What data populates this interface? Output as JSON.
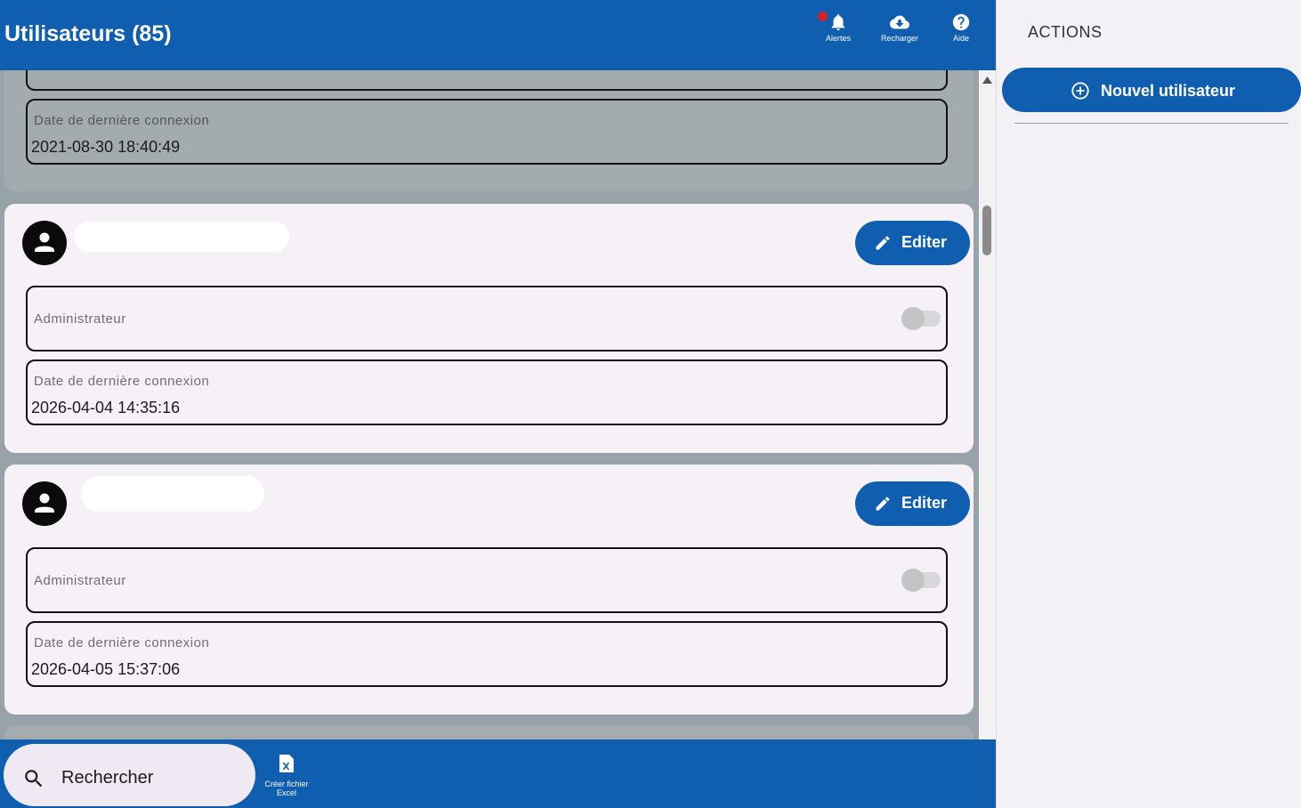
{
  "header": {
    "title": "Utilisateurs (85)",
    "actions": [
      {
        "icon": "bell-icon",
        "label": "Alertes",
        "has_notification": true
      },
      {
        "icon": "cloud-download-icon",
        "label": "Recharger"
      },
      {
        "icon": "help-icon",
        "label": "Aide"
      }
    ]
  },
  "users": [
    {
      "admin_label": "Administrateur",
      "admin": false,
      "last_login_label": "Date de dernière connexion",
      "last_login": "2021-08-30 18:40:49",
      "dimmed": true
    },
    {
      "admin_label": "Administrateur",
      "admin": false,
      "last_login_label": "Date de dernière connexion",
      "last_login": "2026-04-04 14:35:16",
      "edit_label": "Editer"
    },
    {
      "admin_label": "Administrateur",
      "admin": false,
      "last_login_label": "Date de dernière connexion",
      "last_login": "2026-04-05 15:37:06",
      "edit_label": "Editer"
    }
  ],
  "bottom_bar": {
    "search_label": "Rechercher",
    "excel_label_line1": "Créer fichier",
    "excel_label_line2": "Excel"
  },
  "panel": {
    "title": "ACTIONS",
    "new_user_label": "Nouvel utilisateur"
  },
  "colors": {
    "primary": "#0f5eb0",
    "notification": "#d2232a",
    "card_background": "#f6f1f7",
    "overlay_background": "#97a3a9"
  }
}
